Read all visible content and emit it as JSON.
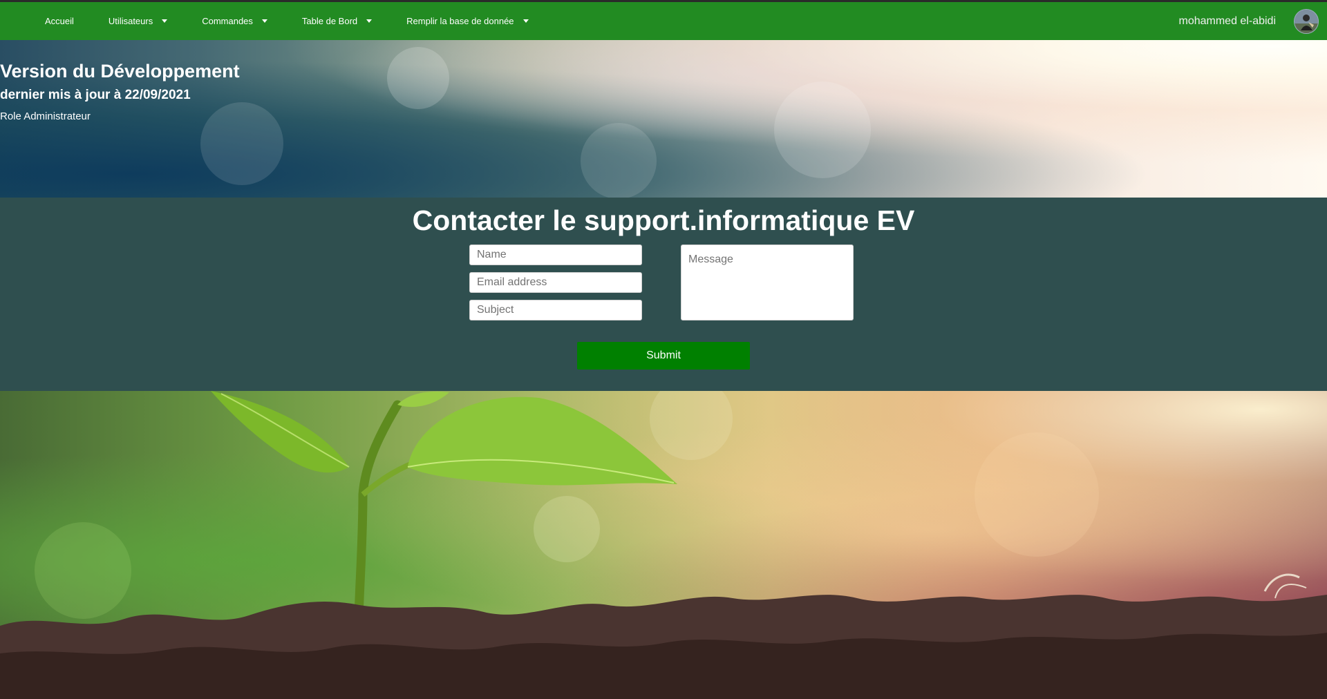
{
  "nav": {
    "items": [
      {
        "label": "Accueil",
        "dropdown": false
      },
      {
        "label": "Utilisateurs",
        "dropdown": true
      },
      {
        "label": "Commandes",
        "dropdown": true
      },
      {
        "label": "Table de Bord",
        "dropdown": true
      },
      {
        "label": "Remplir la base de donnée",
        "dropdown": true
      }
    ],
    "username": "mohammed el-abidi"
  },
  "hero": {
    "title": "Version du Développement",
    "subtitle": "dernier mis à jour à 22/09/2021",
    "role": "Role Administrateur"
  },
  "contact": {
    "title": "Contacter le support.informatique EV",
    "name_placeholder": "Name",
    "email_placeholder": "Email address",
    "subject_placeholder": "Subject",
    "message_placeholder": "Message",
    "submit_label": "Submit"
  },
  "colors": {
    "navbar": "#228b22",
    "contact_bg": "#2f4f4f",
    "submit_bg": "#008000"
  },
  "icons": [
    "caret-down-icon",
    "user-avatar"
  ]
}
